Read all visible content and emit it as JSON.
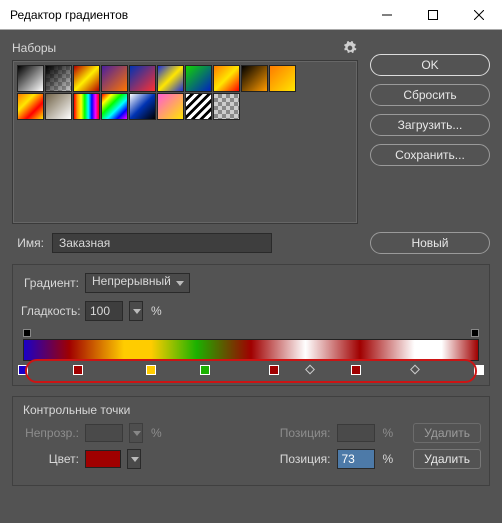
{
  "window": {
    "title": "Редактор градиентов"
  },
  "presets": {
    "label": "Наборы"
  },
  "buttons": {
    "ok": "OK",
    "reset": "Сбросить",
    "load": "Загрузить...",
    "save": "Сохранить...",
    "new": "Новый",
    "delete": "Удалить"
  },
  "name": {
    "label": "Имя:",
    "value": "Заказная"
  },
  "gradient": {
    "type_label": "Градиент:",
    "type_value": "Непрерывный",
    "smooth_label": "Гладкость:",
    "smooth_value": "100",
    "pct": "%"
  },
  "stops": {
    "title": "Контрольные точки",
    "opacity_label": "Непрозр.:",
    "position_label": "Позиция:",
    "color_label": "Цвет:",
    "position_value": "73"
  },
  "color_stops": [
    {
      "pos": 0,
      "color": "#1a00c8"
    },
    {
      "pos": 12,
      "color": "#a00000"
    },
    {
      "pos": 28,
      "color": "#ffcc00"
    },
    {
      "pos": 40,
      "color": "#1bb100"
    },
    {
      "pos": 55,
      "color": "#a00000"
    },
    {
      "pos": 73,
      "color": "#a00000"
    },
    {
      "pos": 100,
      "color": "#ffffff"
    }
  ],
  "midpoints": [
    63,
    86
  ],
  "active_color": "#a00000"
}
